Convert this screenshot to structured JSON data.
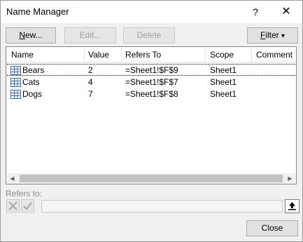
{
  "window": {
    "title": "Name Manager",
    "help_glyph": "?",
    "close_glyph": "✕"
  },
  "toolbar": {
    "new_label_ul": "N",
    "new_label_rest": "ew...",
    "edit_label": "Edit...",
    "delete_label": "Delete",
    "filter_label_ul": "F",
    "filter_label_rest": "ilter",
    "filter_arrow": "▾"
  },
  "table": {
    "columns": [
      "Name",
      "Value",
      "Refers To",
      "Scope",
      "Comment"
    ],
    "rows": [
      {
        "name": "Bears",
        "value": "2",
        "refers_to": "=Sheet1!$F$9",
        "scope": "Sheet1",
        "comment": "",
        "selected": true
      },
      {
        "name": "Cats",
        "value": "4",
        "refers_to": "=Sheet1!$F$7",
        "scope": "Sheet1",
        "comment": "",
        "selected": false
      },
      {
        "name": "Dogs",
        "value": "7",
        "refers_to": "=Sheet1!$F$8",
        "scope": "Sheet1",
        "comment": "",
        "selected": false
      }
    ],
    "row_icon": "named-range-icon"
  },
  "refers_to": {
    "label": "Refers to:",
    "value": ""
  },
  "footer": {
    "close_label": "Close"
  }
}
